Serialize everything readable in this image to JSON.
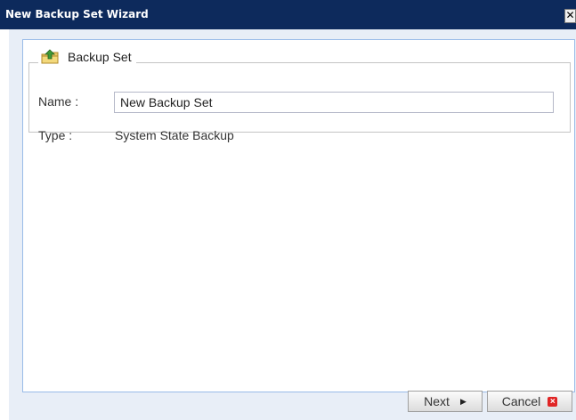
{
  "window": {
    "title": "New Backup Set Wizard",
    "close_glyph": "✕"
  },
  "fieldset": {
    "legend": "Backup Set",
    "icon": "folder-up-arrow-icon"
  },
  "form": {
    "name_label": "Name :",
    "name_value": "New Backup Set",
    "type_label": "Type :",
    "type_value": "System State Backup"
  },
  "buttons": {
    "next_label": "Next",
    "next_icon": "arrow-right-icon",
    "cancel_label": "Cancel",
    "cancel_icon": "cancel-x-icon"
  },
  "colors": {
    "titlebar": "#0d2a5c",
    "dialog_bg": "#e8eef7",
    "panel_border": "#99bbe8"
  }
}
